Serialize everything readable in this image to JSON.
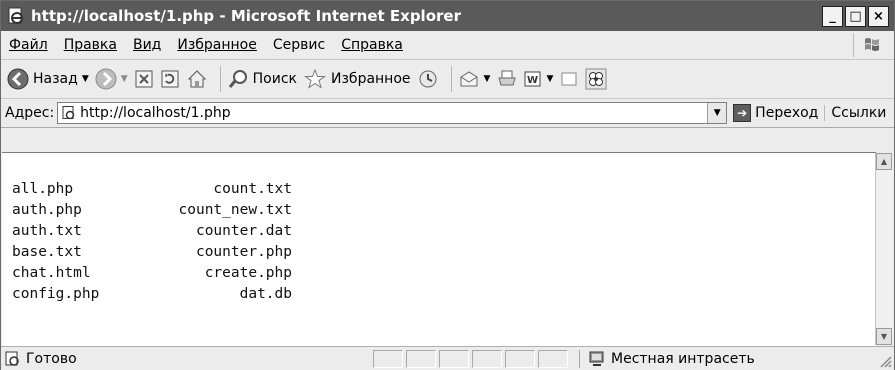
{
  "window": {
    "title": "http://localhost/1.php - Microsoft Internet Explorer"
  },
  "menu": {
    "items": [
      {
        "label": "Файл"
      },
      {
        "label": "Правка"
      },
      {
        "label": "Вид"
      },
      {
        "label": "Избранное"
      },
      {
        "label": "Сервис"
      },
      {
        "label": "Справка"
      }
    ]
  },
  "toolbar": {
    "back_label": "Назад",
    "search_label": "Поиск",
    "favorites_label": "Избранное"
  },
  "address": {
    "label": "Адрес:",
    "url": "http://localhost/1.php",
    "go_label": "Переход",
    "links_label": "Ссылки"
  },
  "content": {
    "rows": [
      {
        "left": "all.php",
        "right": "count.txt"
      },
      {
        "left": "auth.php",
        "right": "count_new.txt"
      },
      {
        "left": "auth.txt",
        "right": "counter.dat"
      },
      {
        "left": "base.txt",
        "right": "counter.php"
      },
      {
        "left": "chat.html",
        "right": "create.php"
      },
      {
        "left": "config.php",
        "right": "dat.db"
      }
    ]
  },
  "status": {
    "text": "Готово",
    "zone": "Местная интрасеть"
  },
  "icons": [
    "ie-page-icon",
    "back-icon",
    "forward-icon",
    "stop-icon",
    "refresh-icon",
    "home-icon",
    "search-icon",
    "favorites-star-icon",
    "history-icon",
    "mail-icon",
    "print-icon",
    "word-icon",
    "discuss-icon",
    "messenger-icon",
    "go-arrow-icon",
    "windows-logo-icon",
    "intranet-icon",
    "resize-grip-icon"
  ]
}
